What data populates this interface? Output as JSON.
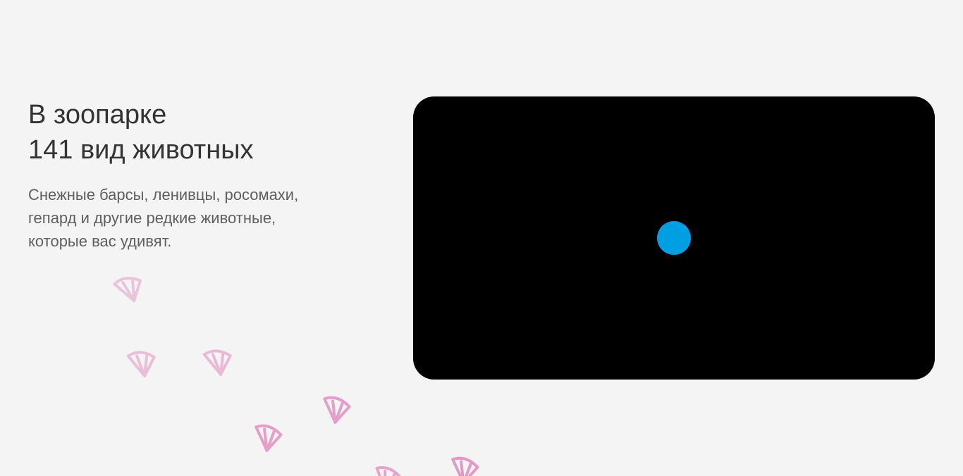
{
  "intro": {
    "title_line1": "В зоопарке",
    "title_line2": "141 вид животных",
    "text_line1": "Снежные барсы, ленивцы, росомахи,",
    "text_line2": "гепард и другие редкие животные,",
    "text_line3": "которые вас удивят."
  },
  "video": {
    "play_icon": "play-dot-icon"
  },
  "decor": {
    "icon": "bird-footprint-icon"
  },
  "colors": {
    "background": "#f4f4f4",
    "title": "#333333",
    "text": "#5f5f5f",
    "video_bg": "#000000",
    "play": "#009ee3",
    "footprint": "#e08bbd"
  }
}
